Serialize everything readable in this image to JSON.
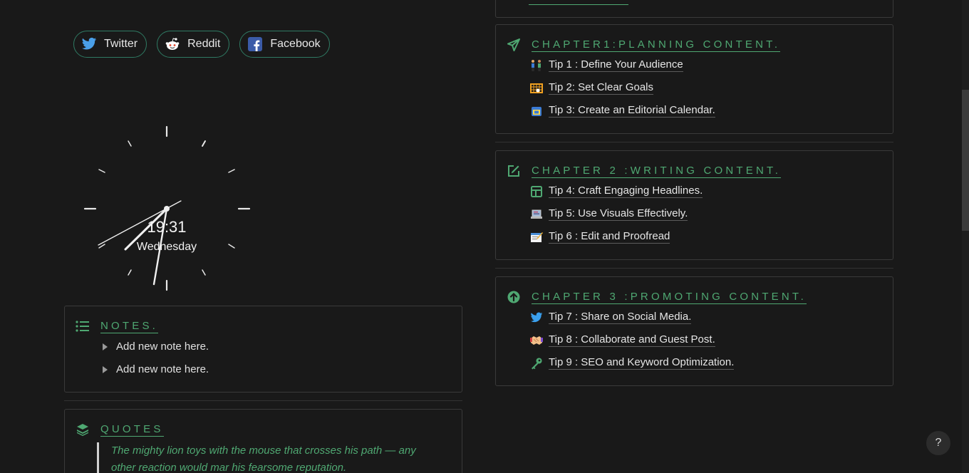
{
  "social": [
    {
      "label": "Twitter",
      "icon": "twitter-bird-icon"
    },
    {
      "label": "Reddit",
      "icon": "reddit-alien-icon"
    },
    {
      "label": "Facebook",
      "icon": "facebook-f-icon"
    }
  ],
  "clock": {
    "time": "19:31",
    "day": "Wednesday"
  },
  "notes": {
    "title": "NOTES.",
    "icon": "list-icon",
    "items": [
      "Add new note here.",
      "Add new note here."
    ]
  },
  "quotes": {
    "title": "QUOTES",
    "icon": "layers-icon",
    "text": "The mighty lion toys with the mouse that crosses his path — any other reaction would mar his fearsome reputation."
  },
  "chapters": [
    {
      "title": "CHAPTER1:PLANNING CONTENT.",
      "icon": "paper-plane-icon",
      "tips": [
        {
          "emoji": "people-icon",
          "label": "Tip 1 : Define Your Audience"
        },
        {
          "emoji": "goal-net-icon",
          "label": "Tip 2: Set Clear Goals"
        },
        {
          "emoji": "calendar-icon",
          "label": "Tip 3: Create an Editorial Calendar."
        }
      ]
    },
    {
      "title": "CHAPTER 2 :WRITING CONTENT.",
      "icon": "edit-icon",
      "tips": [
        {
          "emoji": "headline-icon",
          "label": "Tip 4: Craft Engaging Headlines."
        },
        {
          "emoji": "laptop-icon",
          "label": "Tip 5: Use Visuals Effectively."
        },
        {
          "emoji": "memo-icon",
          "label": "Tip 6 : Edit and Proofread"
        }
      ]
    },
    {
      "title": "CHAPTER 3 :PROMOTING CONTENT.",
      "icon": "arrow-up-circle-icon",
      "tips": [
        {
          "emoji": "twitter-bird-icon",
          "label": "Tip 7 : Share on Social Media."
        },
        {
          "emoji": "handshake-icon",
          "label": "Tip 8 : Collaborate and Guest Post."
        },
        {
          "emoji": "key-icon",
          "label": "Tip 9 : SEO and Keyword Optimization."
        }
      ]
    }
  ],
  "help": {
    "label": "?"
  },
  "colors": {
    "accent": "#4fa872",
    "background": "#191919",
    "border": "#3a3a3a"
  }
}
